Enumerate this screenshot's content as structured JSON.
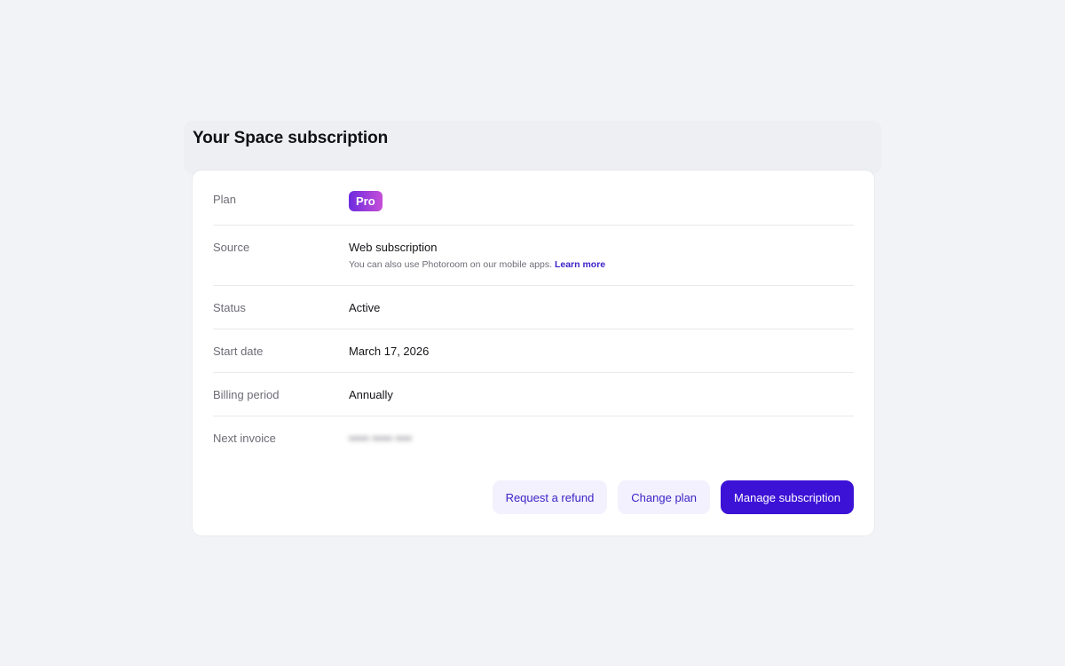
{
  "page": {
    "title": "Your Space subscription"
  },
  "subscription": {
    "plan": {
      "label": "Plan",
      "badge": "Pro"
    },
    "source": {
      "label": "Source",
      "value": "Web subscription",
      "note": "You can also use Photoroom on our mobile apps.",
      "link": "Learn more"
    },
    "status": {
      "label": "Status",
      "value": "Active"
    },
    "start_date": {
      "label": "Start date",
      "value": "March 17, 2026"
    },
    "billing_period": {
      "label": "Billing period",
      "value": "Annually"
    },
    "next_invoice": {
      "label": "Next invoice",
      "value": "••••• ••••• ••••"
    }
  },
  "actions": {
    "refund": "Request a refund",
    "change_plan": "Change plan",
    "manage": "Manage subscription"
  },
  "colors": {
    "background": "#f2f3f6",
    "card": "#ffffff",
    "accent": "#3c12d6",
    "link": "#3b23c8",
    "badge_start": "#6d2bde",
    "badge_end": "#c54ed8"
  }
}
